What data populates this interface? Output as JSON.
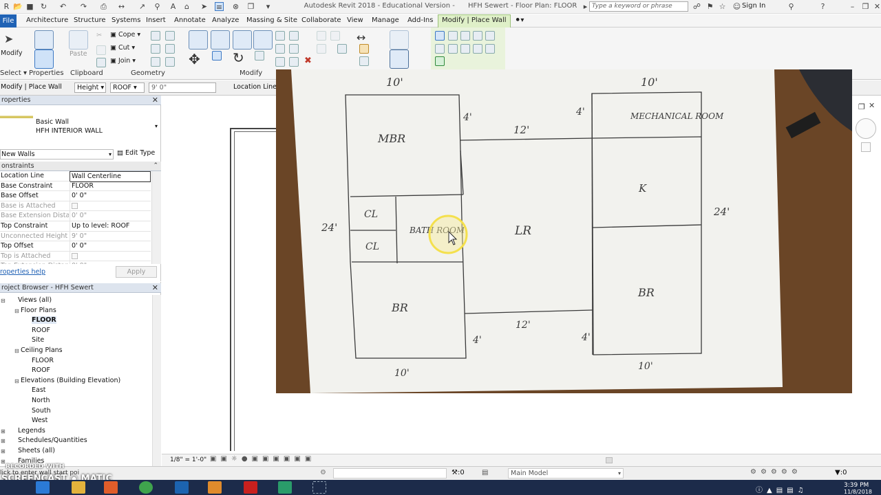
{
  "titlebar": {
    "app_title": "Autodesk Revit 2018 - Educational Version -",
    "project_title": "HFH Sewert - Floor Plan: FLOOR",
    "search_placeholder": "Type a keyword or phrase",
    "sign_in": "Sign In"
  },
  "menu": {
    "file": "File",
    "tabs": [
      "Architecture",
      "Structure",
      "Systems",
      "Insert",
      "Annotate",
      "Analyze",
      "Massing & Site",
      "Collaborate",
      "View",
      "Manage",
      "Add-Ins"
    ],
    "active_tab": "Modify | Place Wall"
  },
  "ribbon": {
    "modify_label": "Modify",
    "paste_label": "Paste",
    "cope": "Cope",
    "cut": "Cut",
    "join": "Join",
    "panels": {
      "select": "Select",
      "properties": "Properties",
      "clipboard": "Clipboard",
      "geometry": "Geometry",
      "modify": "Modify"
    }
  },
  "optionsbar": {
    "context": "Modify | Place Wall",
    "height_mode": "Height",
    "level": "ROOF",
    "height_value": "9'  0\"",
    "location_line_label": "Location Line:"
  },
  "properties": {
    "title": "roperties",
    "type_family": "Basic Wall",
    "type_name": "HFH INTERIOR WALL",
    "instance_filter": "New Walls",
    "edit_type": "Edit Type",
    "section": "onstraints",
    "rows": [
      {
        "k": "Location Line",
        "v": "Wall Centerline",
        "dim": false
      },
      {
        "k": "Base Constraint",
        "v": "FLOOR",
        "dim": false
      },
      {
        "k": "Base Offset",
        "v": "0'  0\"",
        "dim": false
      },
      {
        "k": "Base is Attached",
        "v": "",
        "dim": true,
        "check": true
      },
      {
        "k": "Base Extension Distance",
        "v": "0'  0\"",
        "dim": true
      },
      {
        "k": "Top Constraint",
        "v": "Up to level: ROOF",
        "dim": false
      },
      {
        "k": "Unconnected Height",
        "v": "9'  0\"",
        "dim": true
      },
      {
        "k": "Top Offset",
        "v": "0'  0\"",
        "dim": false
      },
      {
        "k": "Top is Attached",
        "v": "",
        "dim": true,
        "check": true
      },
      {
        "k": "Top Extension Distance",
        "v": "0'  0\"",
        "dim": true
      }
    ],
    "help_link": "roperties help",
    "apply": "Apply"
  },
  "project_browser": {
    "title": "roject Browser - HFH Sewert",
    "items": [
      {
        "label": "Views (all)",
        "level": 0,
        "toggle": "-"
      },
      {
        "label": "Floor Plans",
        "level": 1,
        "toggle": "-"
      },
      {
        "label": "FLOOR",
        "level": 2,
        "bold": true
      },
      {
        "label": "ROOF",
        "level": 2
      },
      {
        "label": "Site",
        "level": 2
      },
      {
        "label": "Ceiling Plans",
        "level": 1,
        "toggle": "-"
      },
      {
        "label": "FLOOR",
        "level": 2
      },
      {
        "label": "ROOF",
        "level": 2
      },
      {
        "label": "Elevations (Building Elevation)",
        "level": 1,
        "toggle": "-"
      },
      {
        "label": "East",
        "level": 2
      },
      {
        "label": "North",
        "level": 2
      },
      {
        "label": "South",
        "level": 2
      },
      {
        "label": "West",
        "level": 2
      },
      {
        "label": "Legends",
        "level": 0,
        "toggle": "+"
      },
      {
        "label": "Schedules/Quantities",
        "level": 0,
        "toggle": "+"
      },
      {
        "label": "Sheets (all)",
        "level": 0,
        "toggle": "+"
      },
      {
        "label": "Families",
        "level": 0,
        "toggle": "+"
      }
    ]
  },
  "sketch": {
    "labels": [
      "10'",
      "10'",
      "4'",
      "4'",
      "12'",
      "MBR",
      "MECHANICAL ROOM",
      "K",
      "CL",
      "CL",
      "BATH ROOM",
      "LR",
      "24'",
      "24'",
      "BR",
      "BR",
      "4'",
      "12'",
      "4'",
      "10'",
      "10'"
    ]
  },
  "viewcontrol": {
    "scale": "1/8\" = 1'-0\""
  },
  "statusbar": {
    "hint": "lick to enter wall start poi",
    "zero_left": ":0",
    "model": "Main Model",
    "zero_right": ":0"
  },
  "watermark": {
    "line1": "RECORDED WITH",
    "line2": "SCREENCAST",
    "line3": "MATIC"
  },
  "clock": {
    "time": "3:39 PM",
    "date": "11/8/2018"
  },
  "colors": {
    "accent": "#1f62b5",
    "context_tab": "#dff0c8",
    "paper": "#f2f2ee",
    "desk": "#6a4526",
    "cursor_ring": "#f4e04d"
  }
}
